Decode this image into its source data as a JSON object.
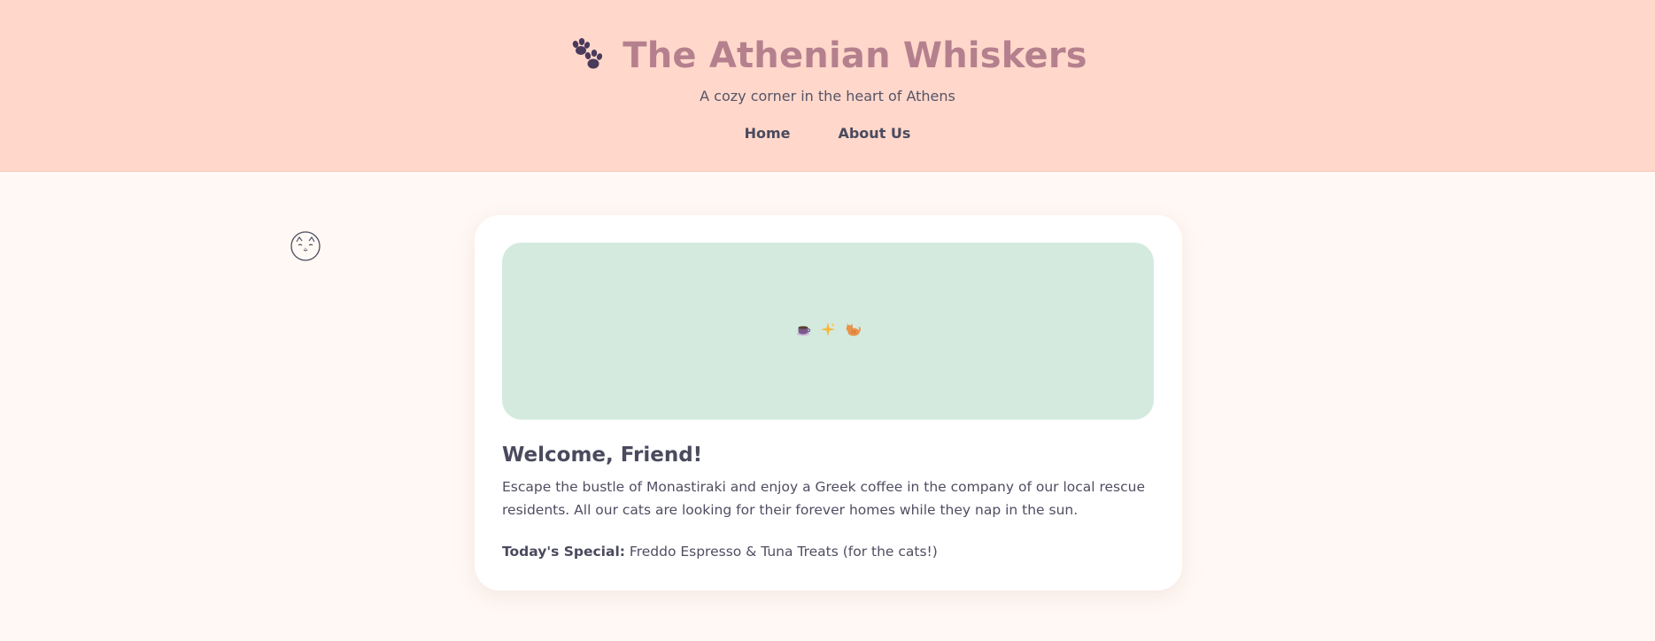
{
  "header": {
    "title": "The Athenian Whiskers",
    "tagline": "A cozy corner in the heart of Athens",
    "logo_icon": "paw-icon",
    "background_color": "#ffd8cb",
    "title_color": "#b5808e"
  },
  "nav": {
    "items": [
      {
        "label": "Home"
      },
      {
        "label": "About Us"
      }
    ]
  },
  "decor": {
    "floating_icon": "cat-face-icon"
  },
  "card": {
    "hero_icons": [
      "coffee-icon",
      "sparkles-icon",
      "cat-icon"
    ],
    "hero_color": "#d4eadf",
    "heading": "Welcome, Friend!",
    "body": "Escape the bustle of Monastiraki and enjoy a Greek coffee in the company of our local rescue residents. All our cats are looking for their forever homes while they nap in the sun.",
    "special_label": "Today's Special:",
    "special_value": "Freddo Espresso & Tuna Treats (for the cats!)"
  },
  "colors": {
    "page_background": "#fff8f4",
    "text": "#4a4a5e"
  }
}
